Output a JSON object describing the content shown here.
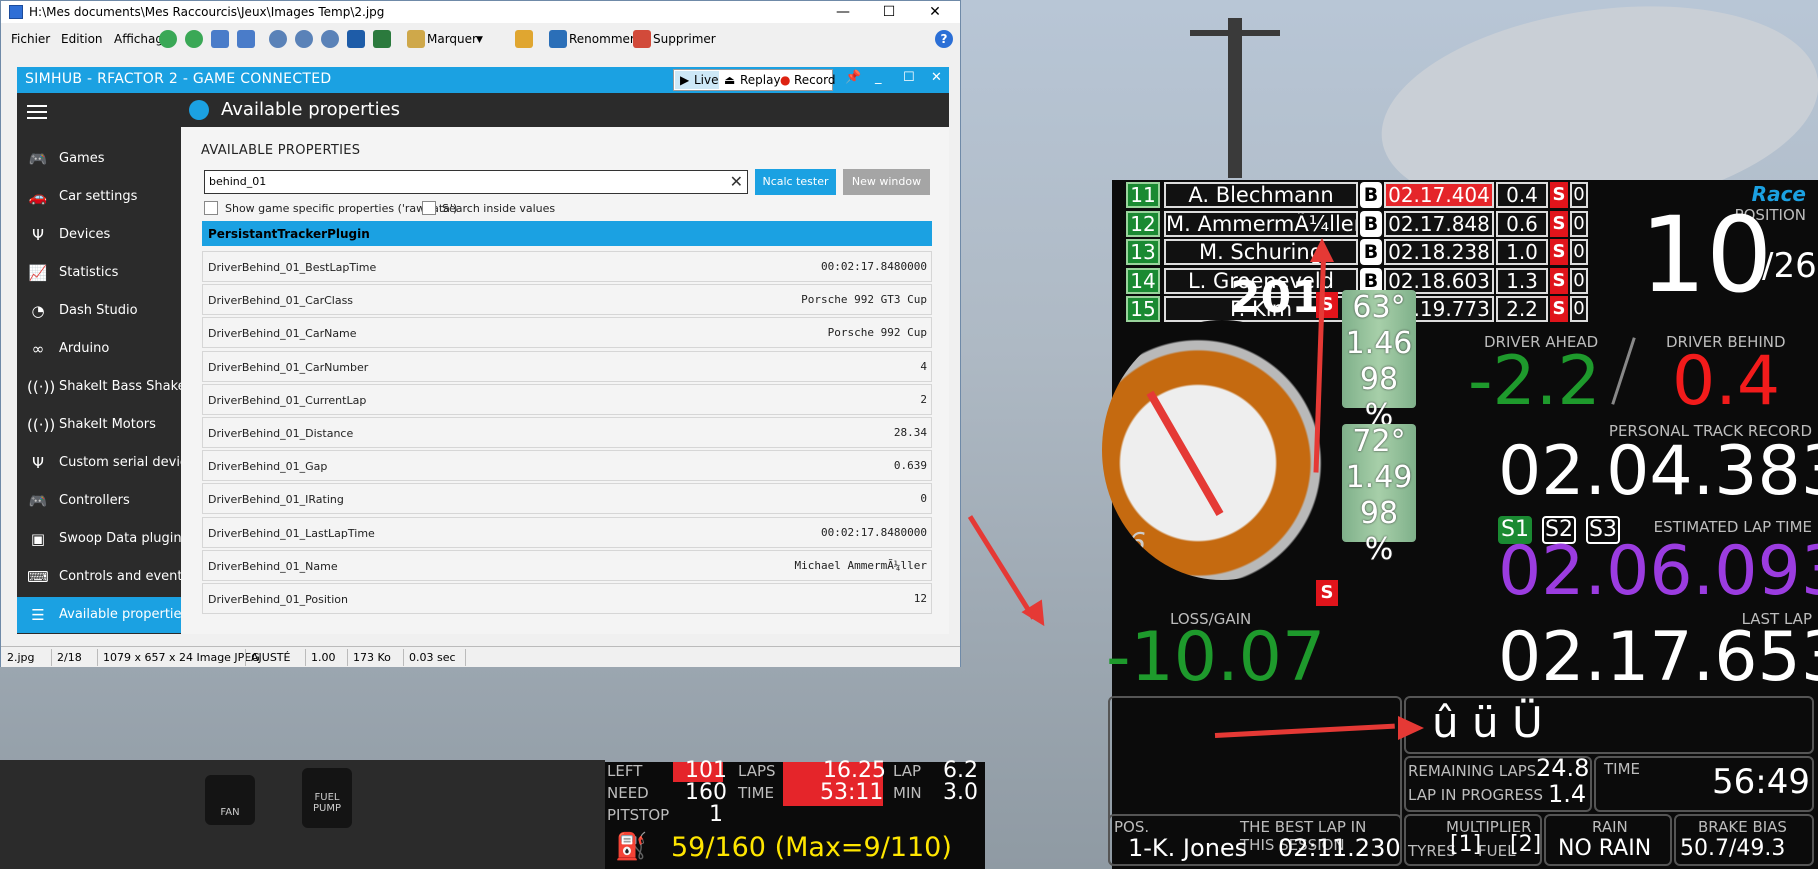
{
  "viewer": {
    "title": "H:\\Mes documents\\Mes Raccourcis\\Jeux\\Images Temp\\2.jpg",
    "menu": [
      "Fichier",
      "Edition",
      "Affichage"
    ],
    "toolbar": {
      "mark": "Marquer",
      "rename": "Renommer",
      "delete": "Supprimer"
    },
    "status": [
      "2.jpg",
      "2/18",
      "1079 x 657 x 24 Image JPEG",
      "AJUSTÉ",
      "1.00",
      "173 Ko",
      "0.03 sec"
    ]
  },
  "simhub": {
    "title": "SIMHUB - RFACTOR 2 - GAME CONNECTED",
    "modes": {
      "live": "Live",
      "replay": "Replay",
      "record": "Record"
    },
    "header": "Available properties",
    "nav": [
      {
        "label": "Games",
        "icon": "gamepad-icon"
      },
      {
        "label": "Car settings",
        "icon": "car-icon"
      },
      {
        "label": "Devices",
        "icon": "usb-icon"
      },
      {
        "label": "Statistics",
        "icon": "chart-icon"
      },
      {
        "label": "Dash Studio",
        "icon": "gauge-icon"
      },
      {
        "label": "Arduino",
        "icon": "arduino-icon"
      },
      {
        "label": "ShakeIt Bass Shakers",
        "icon": "vibration-icon"
      },
      {
        "label": "ShakeIt Motors",
        "icon": "vibration-icon"
      },
      {
        "label": "Custom serial devices",
        "icon": "usb-icon"
      },
      {
        "label": "Controllers",
        "icon": "gamepad-icon"
      },
      {
        "label": "Swoop Data plugin",
        "icon": "sd-card-icon"
      },
      {
        "label": "Controls and events",
        "icon": "keyboard-icon"
      },
      {
        "label": "Available properties",
        "icon": "list-icon"
      }
    ],
    "content": {
      "heading": "AVAILABLE PROPERTIES",
      "search_value": "behind_01",
      "ncalc_button": "Ncalc tester",
      "new_window_button": "New window",
      "checkbox_rawdata": "Show game specific properties ('rawdata')",
      "checkbox_values": "Search inside values",
      "plugin": "PersistantTrackerPlugin",
      "properties": [
        {
          "name": "DriverBehind_01_BestLapTime",
          "value": "00:02:17.8480000"
        },
        {
          "name": "DriverBehind_01_CarClass",
          "value": "Porsche 992 GT3 Cup"
        },
        {
          "name": "DriverBehind_01_CarName",
          "value": "Porsche 992 Cup"
        },
        {
          "name": "DriverBehind_01_CarNumber",
          "value": "4"
        },
        {
          "name": "DriverBehind_01_CurrentLap",
          "value": "2"
        },
        {
          "name": "DriverBehind_01_Distance",
          "value": "28.34"
        },
        {
          "name": "DriverBehind_01_Gap",
          "value": "0.639"
        },
        {
          "name": "DriverBehind_01_IRating",
          "value": "0"
        },
        {
          "name": "DriverBehind_01_LastLapTime",
          "value": "00:02:17.8480000"
        },
        {
          "name": "DriverBehind_01_Name",
          "value": "Michael AmmermÃ¼ller"
        },
        {
          "name": "DriverBehind_01_Position",
          "value": "12"
        }
      ]
    }
  },
  "dash": {
    "standings": [
      {
        "pos": "11",
        "name": "A. Blechmann",
        "tyre": "B",
        "time": "02.17.404",
        "gap": "0.4",
        "s": "S",
        "z": "0",
        "highlight": true
      },
      {
        "pos": "12",
        "name": "M. AmmermÃ¼ller",
        "tyre": "B",
        "time": "02.17.848",
        "gap": "0.6",
        "s": "S",
        "z": "0",
        "highlight": false
      },
      {
        "pos": "13",
        "name": "M. Schuring",
        "tyre": "B",
        "time": "02.18.238",
        "gap": "1.0",
        "s": "S",
        "z": "0",
        "highlight": false
      },
      {
        "pos": "14",
        "name": "L. Groeneveld",
        "tyre": "B",
        "time": "02.18.603",
        "gap": "1.3",
        "s": "S",
        "z": "0",
        "highlight": false
      },
      {
        "pos": "15",
        "name": "F. Kim",
        "tyre": "B",
        "time": "02.19.773",
        "gap": "2.2",
        "s": "S",
        "z": "0",
        "highlight": false
      }
    ],
    "race_label": "Race",
    "position_label": "POSITION",
    "position": "10",
    "position_total": "/26",
    "speed": "201",
    "gear": "6",
    "tyre_front": {
      "temp": "63°",
      "pressure": "1.46",
      "wear": "98 %"
    },
    "tyre_rear": {
      "temp": "72°",
      "pressure": "1.49",
      "wear": "98 %"
    },
    "s_flag": "S",
    "driver_ahead_label": "DRIVER AHEAD",
    "driver_ahead": "-2.2",
    "driver_behind_label": "DRIVER BEHIND",
    "driver_behind": "0.4",
    "ptr_label": "PERSONAL TRACK RECORD",
    "ptr": "02.04.383",
    "sectors": [
      "S1",
      "S2",
      "S3"
    ],
    "estimated_label": "ESTIMATED LAP TIME",
    "estimated": "02.06.093",
    "loss_gain_label": "LOSS/GAIN",
    "loss_gain": "-10.07",
    "last_lap_label": "LAST LAP",
    "last_lap": "02.17.653",
    "chars_test": "û ü Ü",
    "remaining_laps_label": "REMAINING LAPS",
    "remaining_laps": "24.8",
    "lap_in_progress_label": "LAP IN PROGRESS",
    "lap_in_progress": "1.4",
    "time_label": "TIME",
    "time": "56:49",
    "pos_label": "POS.",
    "best_lap_label": "THE BEST LAP IN THIS SESSION",
    "best_lap_driver": "1-K. Jones",
    "best_lap_time": "02:11.230",
    "multiplier_label": "MULTIPLIER",
    "tyres_label": "TYRES",
    "tyres_mult": "[1]",
    "fuel_label": "FUEL",
    "fuel_mult": "[2]",
    "rain_label": "RAIN",
    "rain": "NO RAIN",
    "brake_bias_label": "BRAKE BIAS",
    "brake_bias": "50.7/49.3"
  },
  "strip": {
    "left_label": "LEFT",
    "left": "101",
    "laps_label": "LAPS",
    "laps": "16.25",
    "lap_label": "LAP",
    "lap": "6.2",
    "need_label": "NEED",
    "need": "160",
    "time_label": "TIME",
    "time": "53:11",
    "min_label": "MIN",
    "min": "3.0",
    "pitstop_label": "PITSTOP",
    "pitstop": "1",
    "fuel_summary": "59/160 (Max=9/110)",
    "fan_label": "FAN",
    "fuel_pump_label": "FUEL PUMP"
  }
}
